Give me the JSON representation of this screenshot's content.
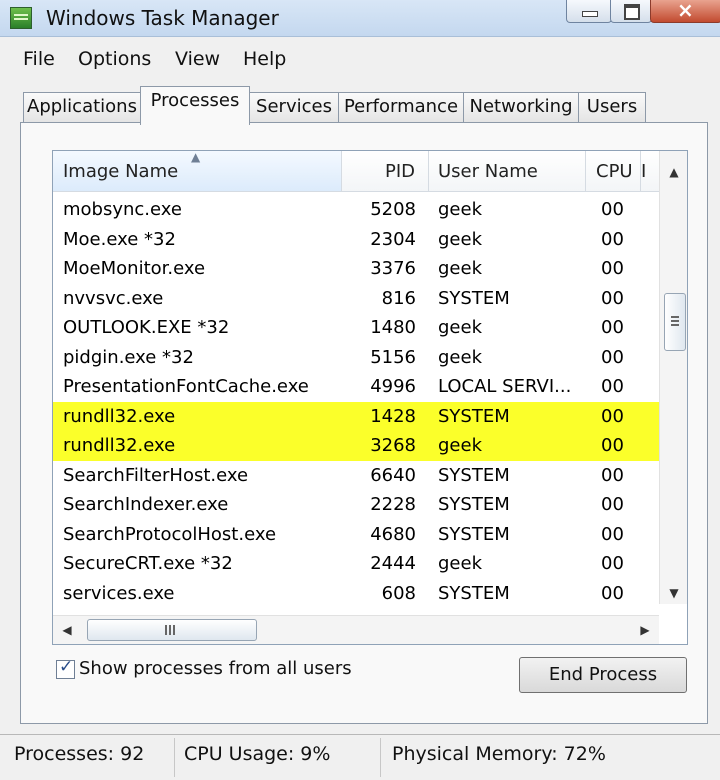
{
  "window": {
    "title": "Windows Task Manager"
  },
  "menu": [
    "File",
    "Options",
    "View",
    "Help"
  ],
  "tabs": [
    "Applications",
    "Processes",
    "Services",
    "Performance",
    "Networking",
    "Users"
  ],
  "table": {
    "columns": [
      "Image Name",
      "PID",
      "User Name",
      "CPU"
    ],
    "rows": [
      {
        "image": "mobsync.exe",
        "pid": "5208",
        "user": "geek",
        "cpu": "00"
      },
      {
        "image": "Moe.exe *32",
        "pid": "2304",
        "user": "geek",
        "cpu": "00"
      },
      {
        "image": "MoeMonitor.exe",
        "pid": "3376",
        "user": "geek",
        "cpu": "00"
      },
      {
        "image": "nvvsvc.exe",
        "pid": "816",
        "user": "SYSTEM",
        "cpu": "00"
      },
      {
        "image": "OUTLOOK.EXE *32",
        "pid": "1480",
        "user": "geek",
        "cpu": "00"
      },
      {
        "image": "pidgin.exe *32",
        "pid": "5156",
        "user": "geek",
        "cpu": "00"
      },
      {
        "image": "PresentationFontCache.exe",
        "pid": "4996",
        "user": "LOCAL SERVI...",
        "cpu": "00"
      },
      {
        "image": "rundll32.exe",
        "pid": "1428",
        "user": "SYSTEM",
        "cpu": "00",
        "highlighted": true
      },
      {
        "image": "rundll32.exe",
        "pid": "3268",
        "user": "geek",
        "cpu": "00",
        "highlighted": true
      },
      {
        "image": "SearchFilterHost.exe",
        "pid": "6640",
        "user": "SYSTEM",
        "cpu": "00"
      },
      {
        "image": "SearchIndexer.exe",
        "pid": "2228",
        "user": "SYSTEM",
        "cpu": "00"
      },
      {
        "image": "SearchProtocolHost.exe",
        "pid": "4680",
        "user": "SYSTEM",
        "cpu": "00"
      },
      {
        "image": "SecureCRT.exe *32",
        "pid": "2444",
        "user": "geek",
        "cpu": "00"
      },
      {
        "image": "services.exe",
        "pid": "608",
        "user": "SYSTEM",
        "cpu": "00"
      }
    ]
  },
  "checkbox": {
    "label": "Show processes from all users",
    "checked": true
  },
  "buttons": {
    "end_process": "End Process"
  },
  "status": {
    "processes": "Processes: 92",
    "cpu_usage": "CPU Usage: 9%",
    "physical_memory": "Physical Memory: 72%"
  },
  "colors": {
    "highlight": "#fbff2a",
    "title_bar": "#d8e6f6"
  }
}
